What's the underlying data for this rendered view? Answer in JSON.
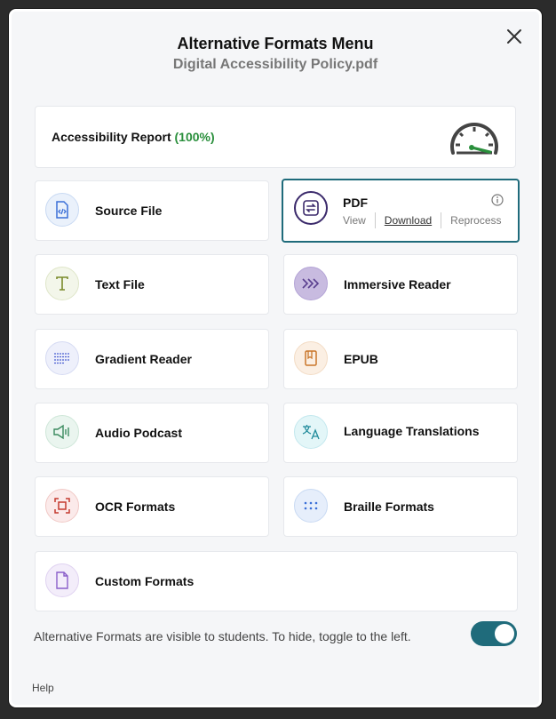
{
  "modal": {
    "title": "Alternative Formats Menu",
    "subtitle": "Digital Accessibility Policy.pdf",
    "close_icon": "close-icon"
  },
  "report": {
    "label": "Accessibility Report",
    "percent": "(100%)",
    "score": 100,
    "gauge_icon": "gauge-icon"
  },
  "formats": {
    "source_file": {
      "label": "Source File",
      "icon": "code-file-icon"
    },
    "pdf": {
      "label": "PDF",
      "icon": "convert-arrows-icon",
      "view": "View",
      "download": "Download",
      "reprocess": "Reprocess",
      "info_icon": "info-icon"
    },
    "text_file": {
      "label": "Text File",
      "icon": "text-t-icon"
    },
    "immersive_reader": {
      "label": "Immersive Reader",
      "icon": "chevrons-right-icon"
    },
    "gradient_reader": {
      "label": "Gradient Reader",
      "icon": "lines-icon"
    },
    "epub": {
      "label": "EPUB",
      "icon": "book-icon"
    },
    "audio_podcast": {
      "label": "Audio Podcast",
      "icon": "speaker-icon"
    },
    "language_translations": {
      "label": "Language Translations",
      "icon": "translate-icon"
    },
    "ocr_formats": {
      "label": "OCR Formats",
      "icon": "scan-icon"
    },
    "braille_formats": {
      "label": "Braille Formats",
      "icon": "braille-dots-icon"
    },
    "custom_formats": {
      "label": "Custom Formats",
      "icon": "document-icon"
    }
  },
  "footer": {
    "visibility_text": "Alternative Formats are visible to students. To hide, toggle to the left.",
    "toggle_on": true,
    "help": "Help"
  },
  "colors": {
    "accent": "#1f6b7b",
    "report_green": "#2a8f3c"
  }
}
